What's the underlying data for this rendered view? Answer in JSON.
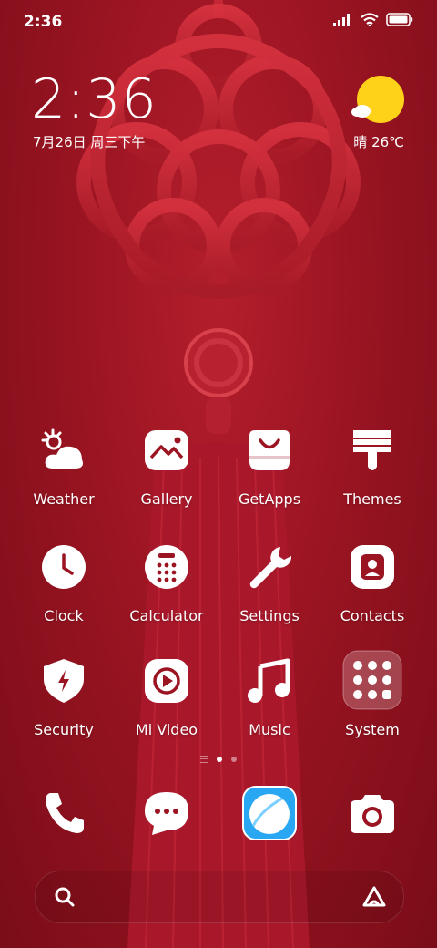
{
  "status_bar": {
    "time": "2:36"
  },
  "clock_widget": {
    "time": "2:36",
    "date": "7月26日 周三下午"
  },
  "weather_widget": {
    "condition_temp": "晴 26℃"
  },
  "apps": [
    {
      "label": "Weather",
      "icon": "weather-icon"
    },
    {
      "label": "Gallery",
      "icon": "gallery-icon"
    },
    {
      "label": "GetApps",
      "icon": "getapps-icon"
    },
    {
      "label": "Themes",
      "icon": "themes-icon"
    },
    {
      "label": "Clock",
      "icon": "clock-icon"
    },
    {
      "label": "Calculator",
      "icon": "calculator-icon"
    },
    {
      "label": "Settings",
      "icon": "settings-icon"
    },
    {
      "label": "Contacts",
      "icon": "contacts-icon"
    },
    {
      "label": "Security",
      "icon": "security-icon"
    },
    {
      "label": "Mi Video",
      "icon": "mi-video-icon"
    },
    {
      "label": "Music",
      "icon": "music-icon"
    },
    {
      "label": "System",
      "icon": "system-folder-icon"
    }
  ],
  "dock": [
    {
      "icon": "phone-icon"
    },
    {
      "icon": "messages-icon"
    },
    {
      "icon": "browser-icon"
    },
    {
      "icon": "camera-icon"
    }
  ],
  "page_indicator": {
    "pages": 2,
    "active": 1
  },
  "colors": {
    "wallpaper": "#9a1422",
    "sun": "#ffd21a",
    "browser_blue": "#2aa7f2"
  }
}
